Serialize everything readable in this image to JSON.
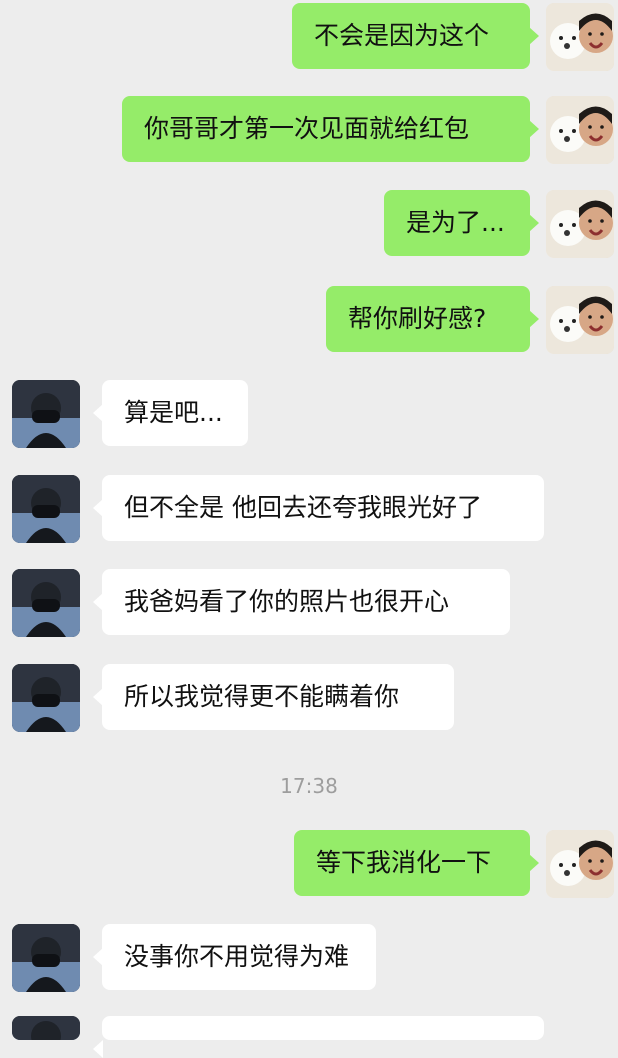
{
  "conversation": {
    "messages": [
      {
        "sender": "me",
        "text": "不会是因为这个"
      },
      {
        "sender": "me",
        "text": "你哥哥才第一次见面就给红包"
      },
      {
        "sender": "me",
        "text": "是为了..."
      },
      {
        "sender": "me",
        "text": "帮你刷好感?"
      },
      {
        "sender": "other",
        "text": "算是吧..."
      },
      {
        "sender": "other",
        "text": "但不全是 他回去还夸我眼光好了"
      },
      {
        "sender": "other",
        "text": "我爸妈看了你的照片也很开心"
      },
      {
        "sender": "other",
        "text": "所以我觉得更不能瞒着你"
      },
      {
        "sender": "me",
        "text": "等下我消化一下"
      },
      {
        "sender": "other",
        "text": "没事你不用觉得为难"
      }
    ],
    "timestamp": "17:38"
  },
  "theme": {
    "background": "#ededed",
    "sent_bubble": "#95ec69",
    "received_bubble": "#ffffff",
    "timestamp_color": "#9d9d9d"
  },
  "icons": {
    "me_avatar": "dog-and-girl-selfie-avatar",
    "other_avatar": "masked-person-avatar"
  }
}
